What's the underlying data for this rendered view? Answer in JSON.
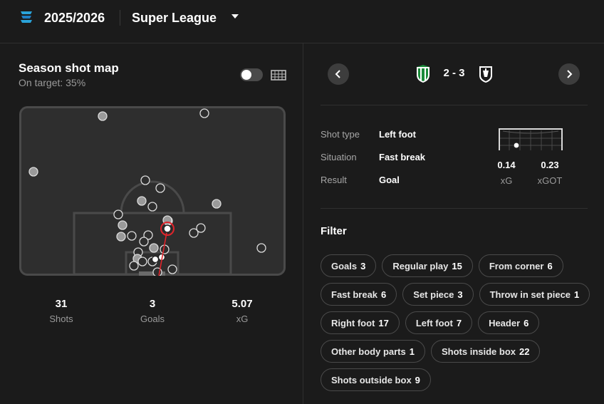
{
  "header": {
    "season": "2025/2026",
    "league": "Super League"
  },
  "shotmap": {
    "title": "Season shot map",
    "subtitle": "On target: 35%",
    "toggle_on": false
  },
  "summary": [
    {
      "value": "31",
      "label": "Shots"
    },
    {
      "value": "3",
      "label": "Goals"
    },
    {
      "value": "5.07",
      "label": "xG"
    }
  ],
  "match": {
    "score": "2 - 3",
    "home_crest": "green-white-striped-crest-icon",
    "away_crest": "black-white-crest-icon"
  },
  "shot_detail": {
    "rows": [
      {
        "label": "Shot type",
        "value": "Left foot"
      },
      {
        "label": "Situation",
        "value": "Fast break"
      },
      {
        "label": "Result",
        "value": "Goal"
      }
    ],
    "xg": {
      "value": "0.14",
      "label": "xG"
    },
    "xgot": {
      "value": "0.23",
      "label": "xGOT"
    }
  },
  "filter": {
    "title": "Filter",
    "chips": [
      {
        "label": "Goals",
        "count": "3"
      },
      {
        "label": "Regular play",
        "count": "15"
      },
      {
        "label": "From corner",
        "count": "6"
      },
      {
        "label": "Fast break",
        "count": "6"
      },
      {
        "label": "Set piece",
        "count": "3"
      },
      {
        "label": "Throw in set piece",
        "count": "1"
      },
      {
        "label": "Right foot",
        "count": "17"
      },
      {
        "label": "Left foot",
        "count": "7"
      },
      {
        "label": "Header",
        "count": "6"
      },
      {
        "label": "Other body parts",
        "count": "1"
      },
      {
        "label": "Shots inside box",
        "count": "22"
      },
      {
        "label": "Shots outside box",
        "count": "9"
      }
    ]
  },
  "colors": {
    "background": "#1b1b1b",
    "highlight": "#e0242b",
    "shot_dot": "#9a9a9a"
  }
}
